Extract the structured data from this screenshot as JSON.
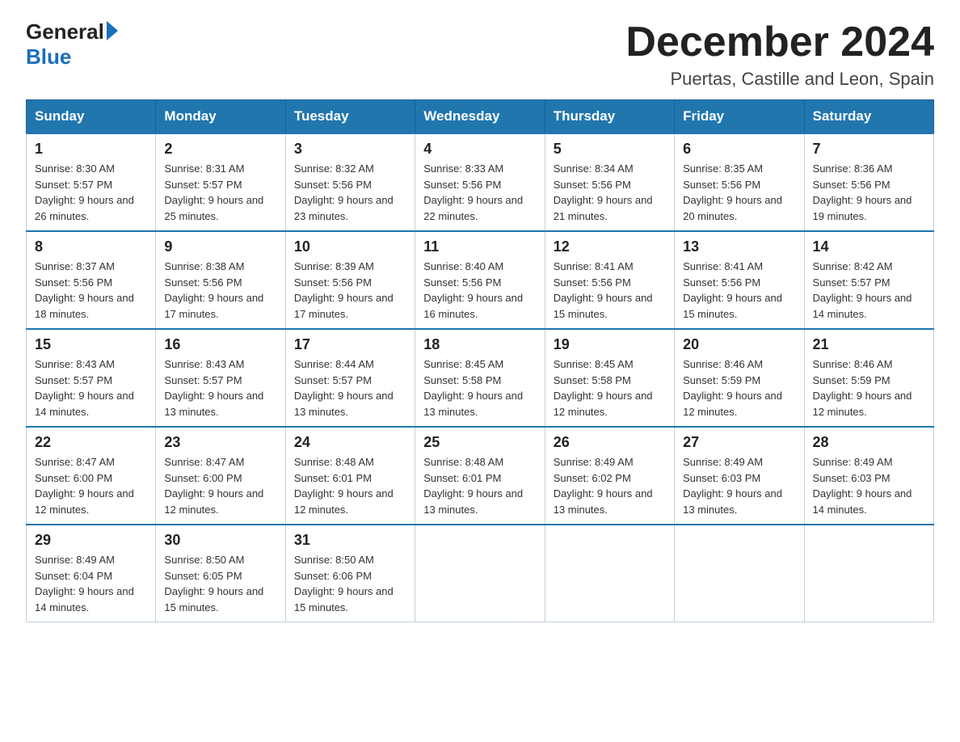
{
  "header": {
    "logo_general": "General",
    "logo_blue": "Blue",
    "month_year": "December 2024",
    "location": "Puertas, Castille and Leon, Spain"
  },
  "days_of_week": [
    "Sunday",
    "Monday",
    "Tuesday",
    "Wednesday",
    "Thursday",
    "Friday",
    "Saturday"
  ],
  "weeks": [
    [
      {
        "day": "1",
        "sunrise": "8:30 AM",
        "sunset": "5:57 PM",
        "daylight": "9 hours and 26 minutes."
      },
      {
        "day": "2",
        "sunrise": "8:31 AM",
        "sunset": "5:57 PM",
        "daylight": "9 hours and 25 minutes."
      },
      {
        "day": "3",
        "sunrise": "8:32 AM",
        "sunset": "5:56 PM",
        "daylight": "9 hours and 23 minutes."
      },
      {
        "day": "4",
        "sunrise": "8:33 AM",
        "sunset": "5:56 PM",
        "daylight": "9 hours and 22 minutes."
      },
      {
        "day": "5",
        "sunrise": "8:34 AM",
        "sunset": "5:56 PM",
        "daylight": "9 hours and 21 minutes."
      },
      {
        "day": "6",
        "sunrise": "8:35 AM",
        "sunset": "5:56 PM",
        "daylight": "9 hours and 20 minutes."
      },
      {
        "day": "7",
        "sunrise": "8:36 AM",
        "sunset": "5:56 PM",
        "daylight": "9 hours and 19 minutes."
      }
    ],
    [
      {
        "day": "8",
        "sunrise": "8:37 AM",
        "sunset": "5:56 PM",
        "daylight": "9 hours and 18 minutes."
      },
      {
        "day": "9",
        "sunrise": "8:38 AM",
        "sunset": "5:56 PM",
        "daylight": "9 hours and 17 minutes."
      },
      {
        "day": "10",
        "sunrise": "8:39 AM",
        "sunset": "5:56 PM",
        "daylight": "9 hours and 17 minutes."
      },
      {
        "day": "11",
        "sunrise": "8:40 AM",
        "sunset": "5:56 PM",
        "daylight": "9 hours and 16 minutes."
      },
      {
        "day": "12",
        "sunrise": "8:41 AM",
        "sunset": "5:56 PM",
        "daylight": "9 hours and 15 minutes."
      },
      {
        "day": "13",
        "sunrise": "8:41 AM",
        "sunset": "5:56 PM",
        "daylight": "9 hours and 15 minutes."
      },
      {
        "day": "14",
        "sunrise": "8:42 AM",
        "sunset": "5:57 PM",
        "daylight": "9 hours and 14 minutes."
      }
    ],
    [
      {
        "day": "15",
        "sunrise": "8:43 AM",
        "sunset": "5:57 PM",
        "daylight": "9 hours and 14 minutes."
      },
      {
        "day": "16",
        "sunrise": "8:43 AM",
        "sunset": "5:57 PM",
        "daylight": "9 hours and 13 minutes."
      },
      {
        "day": "17",
        "sunrise": "8:44 AM",
        "sunset": "5:57 PM",
        "daylight": "9 hours and 13 minutes."
      },
      {
        "day": "18",
        "sunrise": "8:45 AM",
        "sunset": "5:58 PM",
        "daylight": "9 hours and 13 minutes."
      },
      {
        "day": "19",
        "sunrise": "8:45 AM",
        "sunset": "5:58 PM",
        "daylight": "9 hours and 12 minutes."
      },
      {
        "day": "20",
        "sunrise": "8:46 AM",
        "sunset": "5:59 PM",
        "daylight": "9 hours and 12 minutes."
      },
      {
        "day": "21",
        "sunrise": "8:46 AM",
        "sunset": "5:59 PM",
        "daylight": "9 hours and 12 minutes."
      }
    ],
    [
      {
        "day": "22",
        "sunrise": "8:47 AM",
        "sunset": "6:00 PM",
        "daylight": "9 hours and 12 minutes."
      },
      {
        "day": "23",
        "sunrise": "8:47 AM",
        "sunset": "6:00 PM",
        "daylight": "9 hours and 12 minutes."
      },
      {
        "day": "24",
        "sunrise": "8:48 AM",
        "sunset": "6:01 PM",
        "daylight": "9 hours and 12 minutes."
      },
      {
        "day": "25",
        "sunrise": "8:48 AM",
        "sunset": "6:01 PM",
        "daylight": "9 hours and 13 minutes."
      },
      {
        "day": "26",
        "sunrise": "8:49 AM",
        "sunset": "6:02 PM",
        "daylight": "9 hours and 13 minutes."
      },
      {
        "day": "27",
        "sunrise": "8:49 AM",
        "sunset": "6:03 PM",
        "daylight": "9 hours and 13 minutes."
      },
      {
        "day": "28",
        "sunrise": "8:49 AM",
        "sunset": "6:03 PM",
        "daylight": "9 hours and 14 minutes."
      }
    ],
    [
      {
        "day": "29",
        "sunrise": "8:49 AM",
        "sunset": "6:04 PM",
        "daylight": "9 hours and 14 minutes."
      },
      {
        "day": "30",
        "sunrise": "8:50 AM",
        "sunset": "6:05 PM",
        "daylight": "9 hours and 15 minutes."
      },
      {
        "day": "31",
        "sunrise": "8:50 AM",
        "sunset": "6:06 PM",
        "daylight": "9 hours and 15 minutes."
      },
      null,
      null,
      null,
      null
    ]
  ]
}
